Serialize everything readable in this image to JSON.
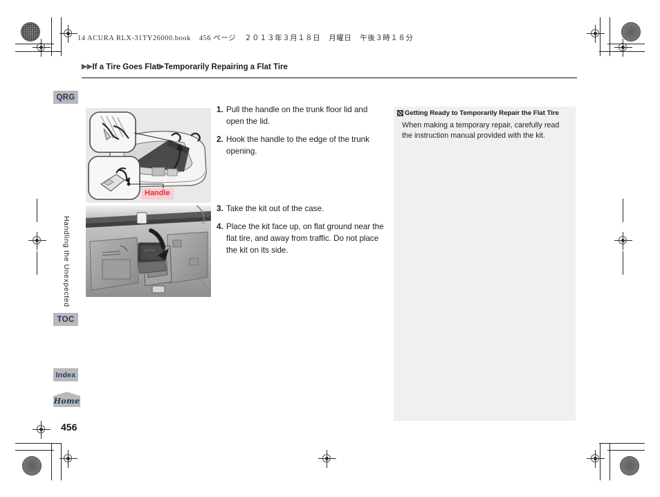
{
  "document": {
    "file_header": [
      "14 ACURA RLX-31TY26000.book",
      "456 ページ",
      "２０１３年３月１８日",
      "月曜日",
      "午後３時１８分"
    ],
    "page_number": "456",
    "chapter_tab": "Handling the Unexpected"
  },
  "breadcrumb": {
    "arrow_double": "▶▶",
    "arrow_single": "▶",
    "level1": "If a Tire Goes Flat",
    "level2": "Temporarily Repairing a Flat Tire"
  },
  "nav": {
    "qrg": "QRG",
    "toc": "TOC",
    "index": "Index",
    "home": "Home"
  },
  "figures": {
    "top": {
      "caption_label": "Handle",
      "caption_color": "#e0313a",
      "caption_bg": "#f7ced3"
    },
    "bottom": {
      "caption_label": ""
    }
  },
  "steps": {
    "group_a": [
      {
        "num": "1.",
        "text": "Pull the handle on the trunk floor lid and open the lid."
      },
      {
        "num": "2.",
        "text": "Hook the handle to the edge of the trunk opening."
      }
    ],
    "group_b": [
      {
        "num": "3.",
        "text": "Take the kit out of the case."
      },
      {
        "num": "4.",
        "text": "Place the kit face up, on flat ground near the flat tire, and away from traffic. Do not place the kit on its side."
      }
    ]
  },
  "note_panel": {
    "marker_icon": "note-marker-icon",
    "title": "Getting Ready to Temporarily Repair the Flat Tire",
    "body": "When making a temporary repair, carefully read the instruction manual provided with the kit.",
    "background": "#f0f0f0"
  }
}
